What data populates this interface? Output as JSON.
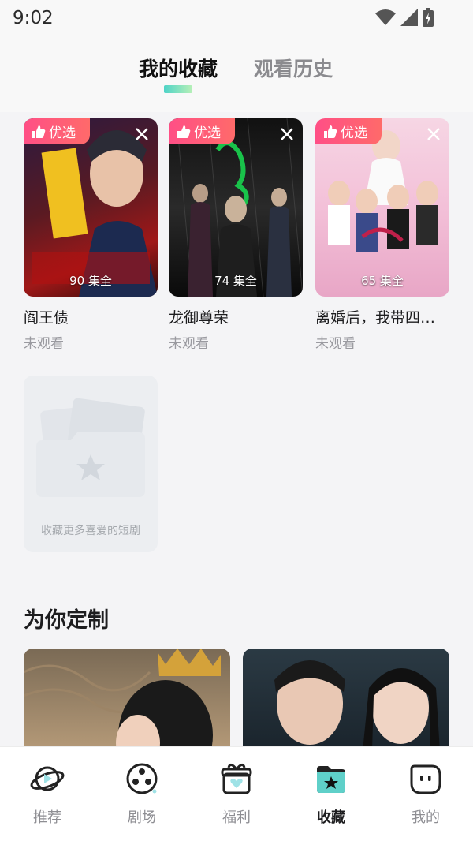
{
  "status": {
    "time": "9:02"
  },
  "tabs": [
    {
      "label": "我的收藏",
      "active": true
    },
    {
      "label": "观看历史",
      "active": false
    }
  ],
  "favorites": [
    {
      "badge": "优选",
      "title": "阎王债",
      "episodes": "90 集全",
      "status": "未观看"
    },
    {
      "badge": "优选",
      "title": "龙御尊荣",
      "episodes": "74 集全",
      "status": "未观看"
    },
    {
      "badge": "优选",
      "title": "离婚后，我带四崽…",
      "episodes": "65 集全",
      "status": "未观看"
    }
  ],
  "empty_card": {
    "text": "收藏更多喜爱的短剧"
  },
  "recommend": {
    "title": "为你定制"
  },
  "nav": [
    {
      "label": "推荐",
      "icon": "planet-play-icon",
      "active": false
    },
    {
      "label": "剧场",
      "icon": "film-reel-icon",
      "active": false
    },
    {
      "label": "福利",
      "icon": "gift-icon",
      "active": false
    },
    {
      "label": "收藏",
      "icon": "folder-star-icon",
      "active": true
    },
    {
      "label": "我的",
      "icon": "profile-face-icon",
      "active": false
    }
  ],
  "colors": {
    "accent": "#ff4f86",
    "indicator": "#4fd3c7"
  }
}
